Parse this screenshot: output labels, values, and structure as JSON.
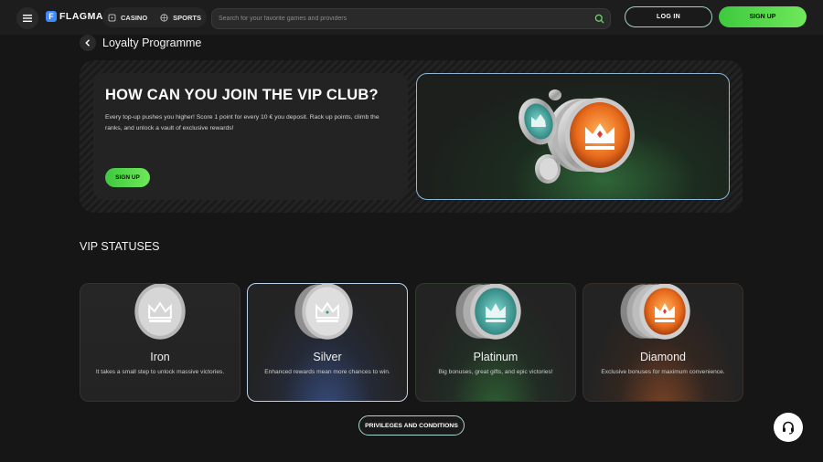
{
  "header": {
    "logo_letter": "F",
    "logo_text": "FLAGMAN",
    "nav": [
      {
        "label": "CASINO",
        "icon": "casino-icon"
      },
      {
        "label": "SPORTS",
        "icon": "sports-ball-icon"
      }
    ],
    "search_placeholder": "Search for your favorite games and providers",
    "login_label": "LOG IN",
    "signup_label": "SIGN UP"
  },
  "page": {
    "title": "Loyalty Programme"
  },
  "hero": {
    "heading": "HOW CAN YOU JOIN THE VIP CLUB?",
    "text": "Every top-up pushes you higher! Score 1 point for every 10 € you deposit. Rack up points, climb the ranks, and unlock a vault of exclusive rewards!",
    "signup_label": "SIGN UP"
  },
  "vip": {
    "title": "VIP STATUSES",
    "statuses": [
      {
        "name": "Iron",
        "desc": "It takes a small step to unlock massive victories."
      },
      {
        "name": "Silver",
        "desc": "Enhanced rewards mean more chances to win."
      },
      {
        "name": "Platinum",
        "desc": "Big bonuses, great gifts, and epic victories!"
      },
      {
        "name": "Diamond",
        "desc": "Exclusive bonuses for maximum convenience."
      }
    ]
  },
  "privileges_label": "PRIVILEGES AND CONDITIONS",
  "colors": {
    "accent_green": "#4cd64a",
    "accent_border": "#9fd3c7",
    "background": "#161616"
  }
}
